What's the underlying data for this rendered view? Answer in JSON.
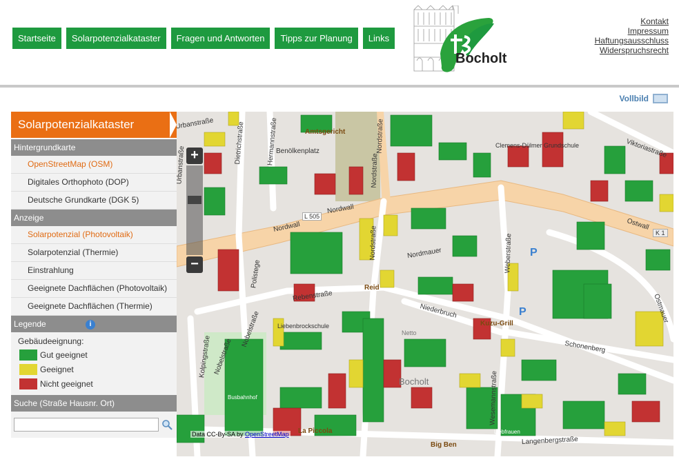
{
  "nav": {
    "items": [
      {
        "label": "Startseite"
      },
      {
        "label": "Solarpotenzialkataster"
      },
      {
        "label": "Fragen und Antworten"
      },
      {
        "label": "Tipps zur Planung"
      },
      {
        "label": "Links"
      }
    ]
  },
  "logo": {
    "text": "Bocholt"
  },
  "toplinks": {
    "kontakt": "Kontakt",
    "impressum": "Impressum",
    "haftung": "Haftungsausschluss",
    "widerspruch": "Widerspruchsrecht"
  },
  "vollbild": "Vollbild",
  "sidebar": {
    "title": "Solarpotenzialkataster",
    "hintergrund": {
      "header": "Hintergrundkarte",
      "items": [
        "OpenStreetMap (OSM)",
        "Digitales Orthophoto (DOP)",
        "Deutsche Grundkarte (DGK 5)"
      ],
      "active": 0
    },
    "anzeige": {
      "header": "Anzeige",
      "items": [
        "Solarpotenzial (Photovoltaik)",
        "Solarpotenzial (Thermie)",
        "Einstrahlung",
        "Geeignete Dachflächen (Photovoltaik)",
        "Geeignete Dachflächen (Thermie)"
      ],
      "active": 0
    },
    "legende": {
      "header": "Legende",
      "subtitle": "Gebäudeeignung:",
      "entries": [
        {
          "label": "Gut geeignet",
          "color": "#26a03c"
        },
        {
          "label": "Geeignet",
          "color": "#e2d632"
        },
        {
          "label": "Nicht geeignet",
          "color": "#c23232"
        }
      ]
    },
    "suche": {
      "header": "Suche (Straße Hausnr. Ort)",
      "placeholder": "",
      "value": ""
    }
  },
  "map": {
    "attribution_prefix": "Data CC-By-SA by",
    "attribution_link": "OpenStreetMap",
    "labels": {
      "amtsgericht": "Amtsgericht",
      "benoelken": "Benölkenplatz",
      "nordwall1": "Nordwall",
      "nordwall2": "Nordwall",
      "l505": "L 505",
      "ostwall": "Ostwall",
      "k1": "K 1",
      "dietrich": "Dietrichstraße",
      "hermann": "Hermannstraße",
      "nordstr1": "Nordstraße",
      "nordstr2": "Nordstraße",
      "nordstr3": "Nordstraße",
      "weber": "Weberstraße",
      "wesemann": "Wesemannstraße",
      "clemens": "Clemens-Dülmer Grundschule",
      "viktoria": "Viktoriastraße",
      "reid": "Reid",
      "rebens": "Rebenstraße",
      "polist": "Polistege",
      "niederbruch": "Niederbruch",
      "kuzu": "Kuzu-Grill",
      "schonenberg": "Schonenberg",
      "ostmauer": "Ostmauer",
      "kolping": "Kolpingstraße",
      "nobel1": "Nobelstraße",
      "nobel2": "Nobelstraße",
      "schule": "Liebenbrockschule",
      "netto": "Netto",
      "bocholt": "Bocholt",
      "piccola": "La Piccola",
      "bigben": "Big Ben",
      "langenberg": "Langenbergstraße",
      "urban": "Urbanstraße",
      "bahnhof": "Busbahnhof",
      "nordmauer": "Nordmauer",
      "urbansk": "Urbanstraße",
      "liebfrauen": "Liebfrauen"
    }
  },
  "colors": {
    "green": "#1e9a3f",
    "orange": "#ea6f14",
    "good": "#26a03c",
    "ok": "#e2d632",
    "bad": "#c23232"
  }
}
